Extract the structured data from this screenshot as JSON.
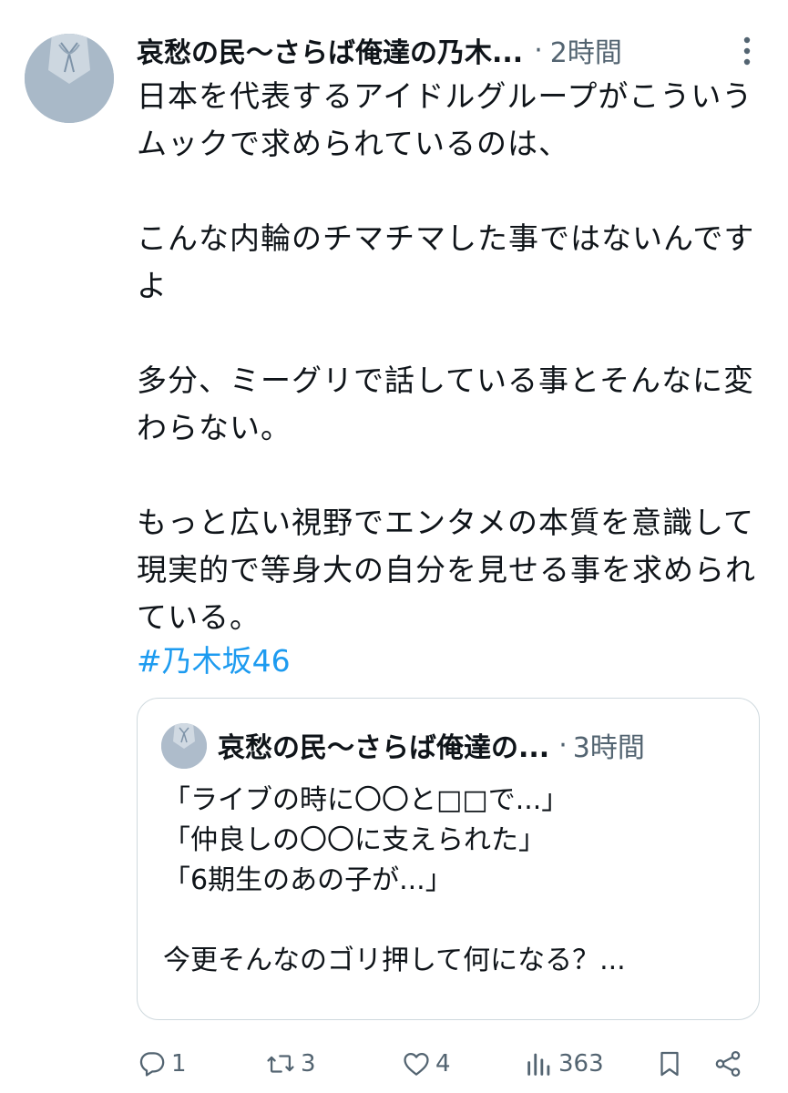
{
  "tweet": {
    "author": "哀愁の民〜さらば俺達の乃木...",
    "separator": "·",
    "time": "2時間",
    "paragraphs": [
      "日本を代表するアイドルグループがこういうムックで求められているのは、",
      "こんな内輪のチマチマした事ではないんですよ",
      "多分、ミーグリで話している事とそんなに変わらない。",
      "もっと広い視野でエンタメの本質を意識して現実的で等身大の自分を見せる事を求められている。"
    ],
    "hashtag": "#乃木坂46"
  },
  "quote": {
    "author": "哀愁の民〜さらば俺達の...",
    "separator": "·",
    "time": "3時間",
    "lines": [
      "「ライブの時に〇〇と□□で...」",
      "「仲良しの〇〇に支えられた」",
      "「6期生のあの子が...」",
      "",
      "今更そんなのゴリ押して何になる？..."
    ]
  },
  "actions": {
    "reply_count": "1",
    "retweet_count": "3",
    "like_count": "4",
    "views_count": "363"
  },
  "icons": {
    "more": "more-vertical-icon",
    "reply": "reply-icon",
    "retweet": "retweet-icon",
    "like": "heart-icon",
    "views": "views-icon",
    "bookmark": "bookmark-icon",
    "share": "share-icon"
  },
  "colors": {
    "text": "#0f1419",
    "secondary": "#536471",
    "hashtag": "#1d9bf0",
    "border": "#cfd9de"
  }
}
